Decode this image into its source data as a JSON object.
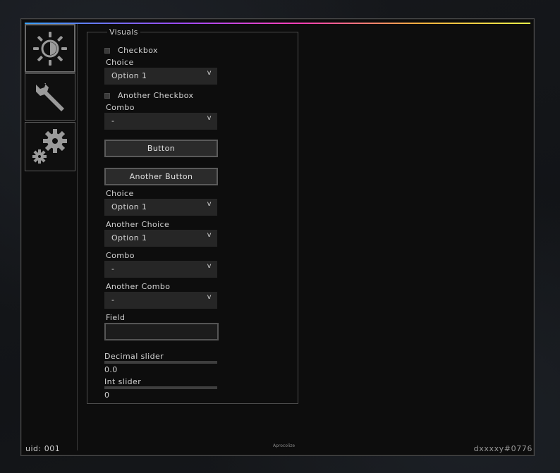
{
  "tabs": [
    {
      "name": "visuals",
      "icon": "brightness-icon",
      "active": true
    },
    {
      "name": "misc",
      "icon": "wrench-icon",
      "active": false
    },
    {
      "name": "settings",
      "icon": "gears-icon",
      "active": false
    }
  ],
  "group": {
    "title": "Visuals",
    "checkbox1": "Checkbox",
    "choice1_label": "Choice",
    "choice1_value": "Option 1",
    "checkbox2": "Another Checkbox",
    "combo1_label": "Combo",
    "combo1_value": "-",
    "button1": "Button",
    "button2": "Another Button",
    "choice2_label": "Choice",
    "choice2_value": "Option 1",
    "choice3_label": "Another Choice",
    "choice3_value": "Option 1",
    "combo2_label": "Combo",
    "combo2_value": "-",
    "combo3_label": "Another Combo",
    "combo3_value": "-",
    "field_label": "Field",
    "field_value": "",
    "decimal_slider_label": "Decimal slider",
    "decimal_slider_value": "0.0",
    "int_slider_label": "Int slider",
    "int_slider_value": "0",
    "dropdown_arrow": "v"
  },
  "footer": {
    "uid": "uid: 001",
    "center": "Aprocolize",
    "user": "dxxxxy#0776"
  },
  "colors": {
    "accent_gradient": [
      "#3aa0ff",
      "#9a4cff",
      "#ff3fb4",
      "#ffb13f",
      "#e8f04a"
    ],
    "background": "#0d0d0d"
  }
}
